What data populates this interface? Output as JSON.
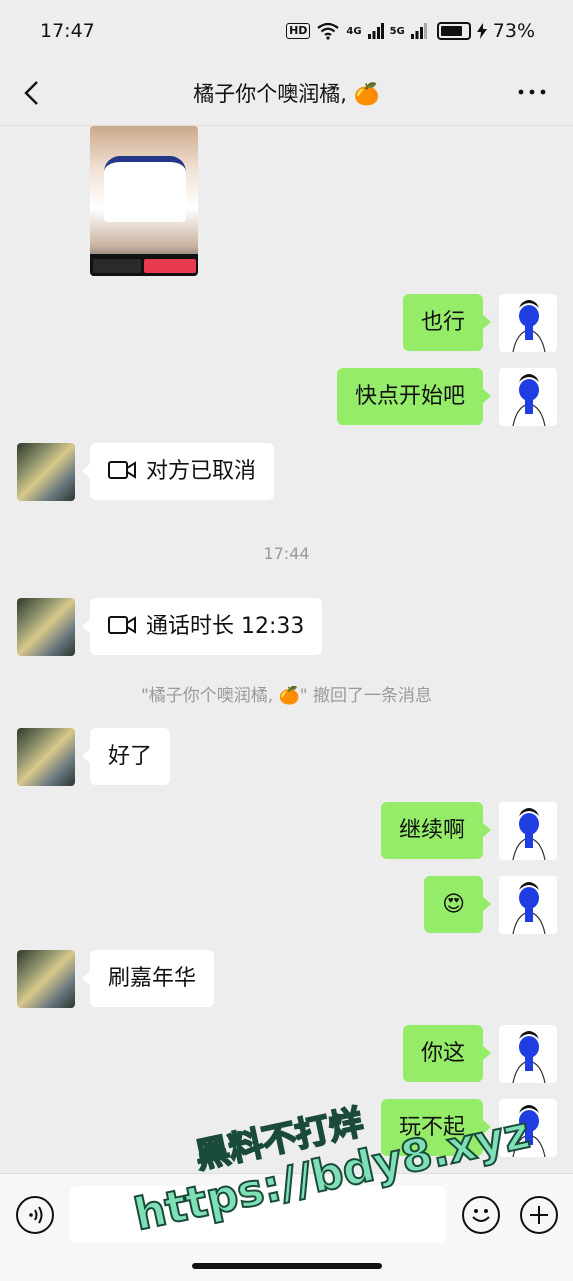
{
  "status": {
    "time": "17:47",
    "hd": "HD",
    "net1": "4G",
    "net2": "5G",
    "battery": "73%"
  },
  "header": {
    "title": "橘子你个噢润橘, 🍊"
  },
  "messages": {
    "m1": "也行",
    "m2": "快点开始吧",
    "m3": "对方已取消",
    "time1": "17:44",
    "m4": "通话时长 12:33",
    "recall": "\"橘子你个噢润橘, 🍊\" 撤回了一条消息",
    "m5": "好了",
    "m6": "继续啊",
    "m7": "😍",
    "m8": "刷嘉年华",
    "m9": "你这",
    "m10": "玩不起"
  },
  "watermark": {
    "line1": "黑料不打烊",
    "line2": "https://bdy8.xyz"
  },
  "colors": {
    "outgoing_bubble": "#95ec69",
    "incoming_bubble": "#ffffff",
    "background": "#ededed"
  }
}
